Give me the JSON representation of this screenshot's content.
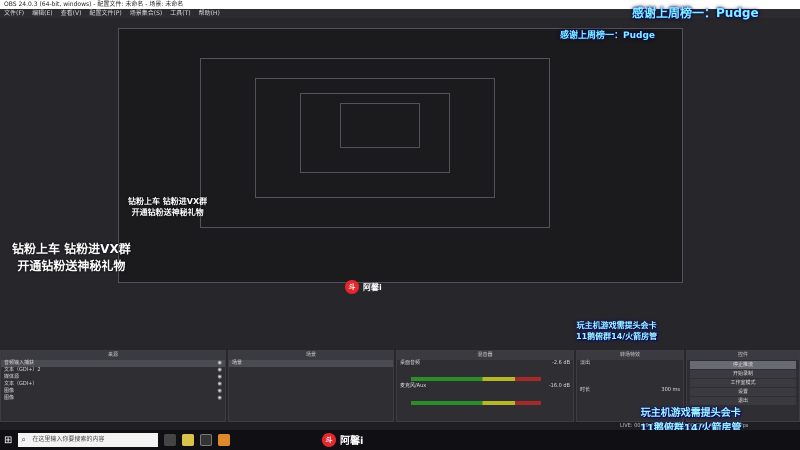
{
  "window": {
    "title": "OBS 24.0.3 (64-bit, windows) - 配置文件: 未命名 - 场景: 未命名"
  },
  "menu": [
    "文件(F)",
    "编辑(E)",
    "查看(V)",
    "配置文件(P)",
    "场景集合(S)",
    "工具(T)",
    "帮助(H)"
  ],
  "overlays": {
    "top_right": "感谢上周榜一：Pudge",
    "left_line1": "钻粉上车 钻粉进VX群",
    "left_line2": "开通钻粉送神秘礼物",
    "bottom_right_line1": "玩主机游戏需提头会卡",
    "bottom_right_line2": "11鹅俯群14/火箭房管"
  },
  "docks": {
    "sources": {
      "title": "来源",
      "items": [
        "音频输入捕获",
        "文本（GDI+）2",
        "媒体源",
        "文本（GDI+）",
        "图像",
        "图像"
      ]
    },
    "scenes": {
      "title": "场景",
      "items": [
        "场景"
      ]
    },
    "mixer": {
      "title": "混音器",
      "channels": [
        {
          "name": "桌面音频",
          "db": "-2.6 dB"
        },
        {
          "name": "麦克风/Aux",
          "db": "-16.0 dB"
        }
      ]
    },
    "transitions": {
      "title": "转场特效",
      "type": "淡出",
      "duration_label": "时长",
      "duration": "300 ms"
    },
    "controls": {
      "title": "控件",
      "buttons": [
        "停止推流",
        "开始录制",
        "工作室模式",
        "设置",
        "退出"
      ]
    }
  },
  "status": {
    "text": "LIVE: 00:16:49  REC: 00:00:00  CPU: 4.7%, 60.00 fps"
  },
  "taskbar": {
    "search_placeholder": "在这里输入你要搜索的内容"
  },
  "brand": {
    "name": "阿馨i",
    "logo_char": "斗"
  },
  "colors": {
    "accent_cyan": "#7ef3ff",
    "logo_red": "#e4272d",
    "meter_green": "#2a8f2a"
  }
}
